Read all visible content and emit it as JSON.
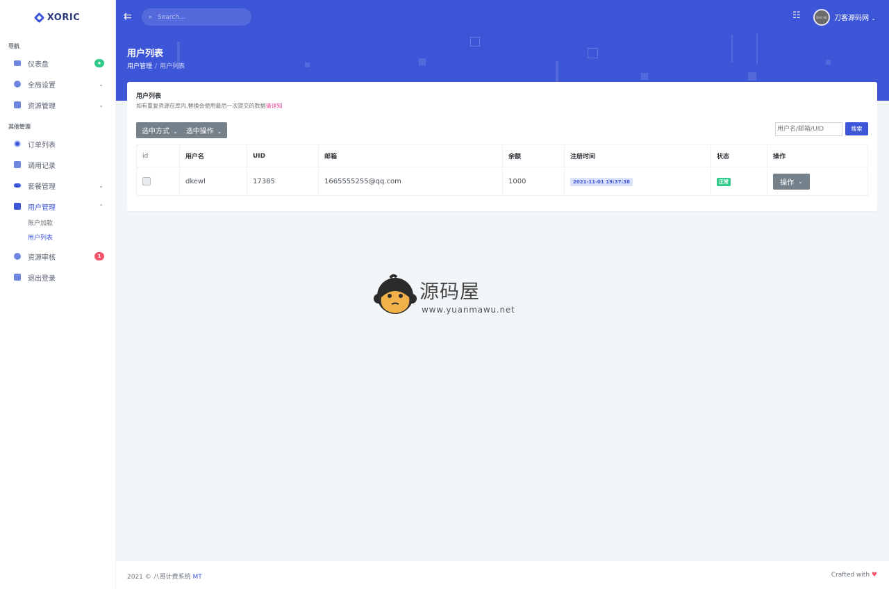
{
  "app": {
    "brand": "XORIC"
  },
  "sidebar": {
    "section_nav": "导航",
    "section_other": "其他管理",
    "items": [
      {
        "label": "仪表盘",
        "badge": "★",
        "badge_color": "#2fc98a"
      },
      {
        "label": "全局设置"
      },
      {
        "label": "资源管理"
      },
      {
        "label": "订单列表"
      },
      {
        "label": "调用记录"
      },
      {
        "label": "套餐管理"
      },
      {
        "label": "用户管理"
      },
      {
        "label": "资源审核",
        "badge": "1",
        "badge_color": "#f1556c"
      },
      {
        "label": "退出登录"
      }
    ],
    "sub_items": [
      {
        "label": "账户加款"
      },
      {
        "label": "用户列表"
      }
    ]
  },
  "header": {
    "search_placeholder": "Search...",
    "user_name": "刀客源码网",
    "avatar_text": "DAO KE",
    "page_title": "用户列表",
    "breadcrumb": {
      "parent": "用户管理",
      "current": "用户列表"
    }
  },
  "card": {
    "title": "用户列表",
    "desc": "如有重复资源在库内,替换会使用最后一次提交的数据",
    "desc_link": "请详知",
    "select_mode": "选中方式",
    "select_action": "选中操作",
    "search_placeholder": "用户名/邮箱/UID",
    "search_button": "搜索"
  },
  "table": {
    "headers": [
      "id",
      "用户名",
      "UID",
      "邮箱",
      "余额",
      "注册时间",
      "状态",
      "操作"
    ],
    "rows": [
      {
        "username": "dkewl",
        "uid": "17385",
        "email": "1665555255@qq.com",
        "balance": "1000",
        "reg_time": "2021-11-01 19:37:38",
        "status": "正常",
        "action": "操作"
      }
    ]
  },
  "watermark": {
    "name": "源码屋",
    "url": "www.yuanmawu.net"
  },
  "footer": {
    "left": "2021 © 八哥计费系统",
    "left_suffix": "MT",
    "right": "Crafted with"
  },
  "colors": {
    "primary": "#3d55d7",
    "success": "#2fc98a",
    "danger": "#f1556c",
    "secondary": "#74808a"
  }
}
